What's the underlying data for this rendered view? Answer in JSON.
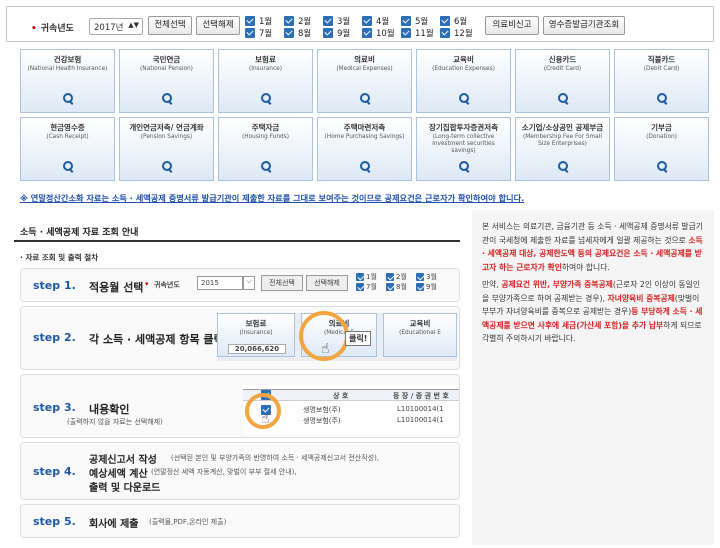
{
  "filter": {
    "year_label": "귀속년도",
    "year_value": "2017년",
    "select_all": "전체선택",
    "deselect_all": "선택해제",
    "months": [
      "1월",
      "2월",
      "3월",
      "4월",
      "5월",
      "6월",
      "7월",
      "8월",
      "9월",
      "10월",
      "11월",
      "12월"
    ],
    "medical_btn": "의료비신고",
    "receipt_btn": "영수증발급기관조회"
  },
  "tiles": [
    {
      "label": "건강보험",
      "sub": "(National Health Insurance)"
    },
    {
      "label": "국민연금",
      "sub": "(National Pension)"
    },
    {
      "label": "보험료",
      "sub": "(Insurance)"
    },
    {
      "label": "의료비",
      "sub": "(Medical Expenses)"
    },
    {
      "label": "교육비",
      "sub": "(Education Expenses)"
    },
    {
      "label": "신용카드",
      "sub": "(Credit Card)"
    },
    {
      "label": "직불카드",
      "sub": "(Debit Card)"
    },
    {
      "label": "현금영수증",
      "sub": "(Cash Receipt)"
    },
    {
      "label": "개인연금저축/ 연금계좌",
      "sub": "(Pension Savings)"
    },
    {
      "label": "주택자금",
      "sub": "(Housing Funds)"
    },
    {
      "label": "주택마련저축",
      "sub": "(Home Purchasing Savings)"
    },
    {
      "label": "장기집합투자증권저축",
      "sub": "(Long-term collective investment securities savings)"
    },
    {
      "label": "소기업/소상공인 공제부금",
      "sub": "(Membership Fee For Small Size Enterprises)"
    },
    {
      "label": "기부금",
      "sub": "(Donation)"
    }
  ],
  "notice": "※ 연말정산간소화 자료는 소득 · 세액공제 증명서류 발급기관이 제출한 자료를 그대로 보여주는 것이므로 공제요건은 근로자가 확인하여야 합니다.",
  "guide": {
    "title": "소득 · 세액공제 자료 조회 안내",
    "subtitle": "· 자료 조회 및 출력 절차",
    "steps": [
      {
        "num": "step 1.",
        "label": "적용월 선택"
      },
      {
        "num": "step 2.",
        "label": "각 소득 · 세액공제 항목 클릭"
      },
      {
        "num": "step 3.",
        "label": "내용확인",
        "note": "(출력하지 않을 자료는 선택해제)"
      },
      {
        "num": "step 4.",
        "label1": "공제신고서 작성",
        "label2": "예상세액 계산",
        "label3": "출력 및 다운로드",
        "note1": "(선택된 본인 및 부양가족의 반영하여 소득 · 세액공제신고서 전산작성),",
        "note2": "(연말정산 세액 자동계산, 맞벌이 부부 절세 안내),"
      },
      {
        "num": "step 5.",
        "label": "회사에 제출",
        "note": "(출력물,PDF,온라인 제출)"
      }
    ],
    "ill1": {
      "year_label": "귀속년도",
      "year": "2015",
      "btn1": "전체선택",
      "btn2": "선택해제",
      "months": [
        "1월",
        "2월",
        "3월",
        "7월",
        "8월",
        "9월"
      ]
    },
    "ill2": {
      "t1": "보험료",
      "t1s": "(Insurance)",
      "amount": "20,066,620",
      "t2": "의료비",
      "t2s": "(Medical E",
      "click": "클릭!",
      "t3": "교육비",
      "t3s": "(Educational E"
    },
    "ill3": {
      "h1": "상 호",
      "h2": "등 장 / 증 권 번 호",
      "r1": "생명보험(주)",
      "r1n": "L10100014(1",
      "r2": "생명보험(주)",
      "r2n": "L10100014(1"
    }
  },
  "right_panel": {
    "p1a": "본 서비스는 의료기관, 금융기관 등 소득 · 세액공제 증명서류 발급기관이 국세청에 제출한 자료를 넘세자에게 일괄 제공하는 것으로 ",
    "p1b": "소득 · 세액공제 대상, 공제한도액 등의 공제요건은 소득 · 세액공제를 받고자 하는 근로자가 확인",
    "p1c": "하여야 합니다.",
    "p2a": "만약, ",
    "p2b": "공제요건 위반, 부양가족 중복공제",
    "p2c": "(근로자 2인 이상이 동일인을 부양가족으로 하여 공제받는 경우), ",
    "p2d": "자녀양육비 중복공제",
    "p2e": "(맞벌이 부부가 자녀양육비를 중복으로 공제받는 경우)",
    "p2f": "등 부당하게 소득 · 세액공제를 받으면 사후에 세금(가산세 포함)을 추가 납부",
    "p2g": "하게 되므로 각별히 주의하시기 바랍니다."
  }
}
